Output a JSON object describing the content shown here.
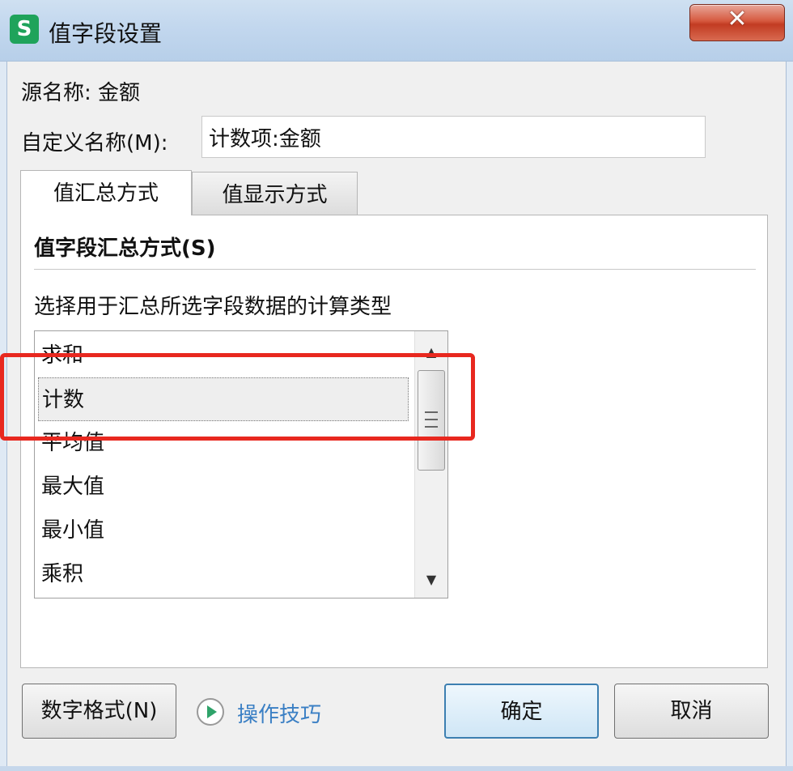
{
  "window": {
    "title": "值字段设置",
    "app_icon_letter": "S",
    "close_glyph": "✕"
  },
  "source_name": "源名称: 金额",
  "custom_name": {
    "label": "自定义名称(M):",
    "value": "计数项:金额"
  },
  "tabs": [
    {
      "label": "值汇总方式",
      "active": true
    },
    {
      "label": "值显示方式",
      "active": false
    }
  ],
  "summary": {
    "group_title": "值字段汇总方式(S)",
    "hint": "选择用于汇总所选字段数据的计算类型",
    "items": [
      "求和",
      "计数",
      "平均值",
      "最大值",
      "最小值",
      "乘积"
    ],
    "selected_index": 1
  },
  "buttons": {
    "number_format": "数字格式(N)",
    "tips": "操作技巧",
    "ok": "确定",
    "cancel": "取消"
  },
  "colors": {
    "highlight": "#e8281f",
    "link": "#3a7fc4",
    "app_icon": "#1fa35b"
  }
}
